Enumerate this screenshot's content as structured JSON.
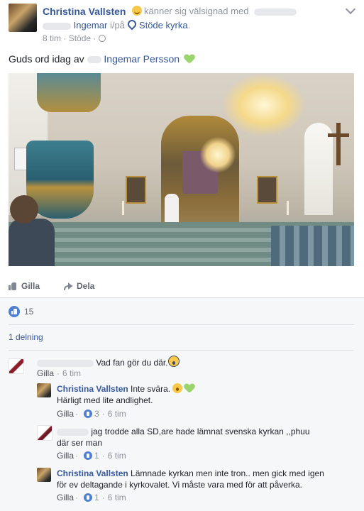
{
  "post": {
    "author": "Christina Vallsten",
    "feeling": "känner sig välsignad med",
    "tagged_name": "Ingemar",
    "at_label": "i/på",
    "location": "Stöde kyrka",
    "time": "8 tim",
    "place_short": "Stöde",
    "text_before": "Guds ord idag av",
    "text_link": "Ingemar Persson"
  },
  "actions": {
    "like": "Gilla",
    "share": "Dela"
  },
  "reactions": {
    "count": "15"
  },
  "shares": "1 delning",
  "comments": [
    {
      "author": "",
      "text": "Vad fan gör du där.",
      "like_label": "Gilla",
      "time": "6 tim",
      "likes": ""
    },
    {
      "author": "Christina Vallsten",
      "text": "Inte svära.",
      "text2": "Härligt med lite andlighet.",
      "like_label": "Gilla",
      "likes": "3",
      "time": "6 tim"
    },
    {
      "author": "",
      "text": "jag trodde alla SD,are hade lämnat svenska kyrkan ,,phuu",
      "text2": "där ser man",
      "like_label": "Gilla",
      "likes": "1",
      "time": "6 tim"
    },
    {
      "author": "Christina Vallsten",
      "text": "Lämnade kyrkan men inte tron.. men gick med igen",
      "text2": "för ev deltagande i kyrkovalet. Vi måste vara med för att påverka.",
      "like_label": "Gilla",
      "likes": "1",
      "time": "6 tim"
    }
  ]
}
